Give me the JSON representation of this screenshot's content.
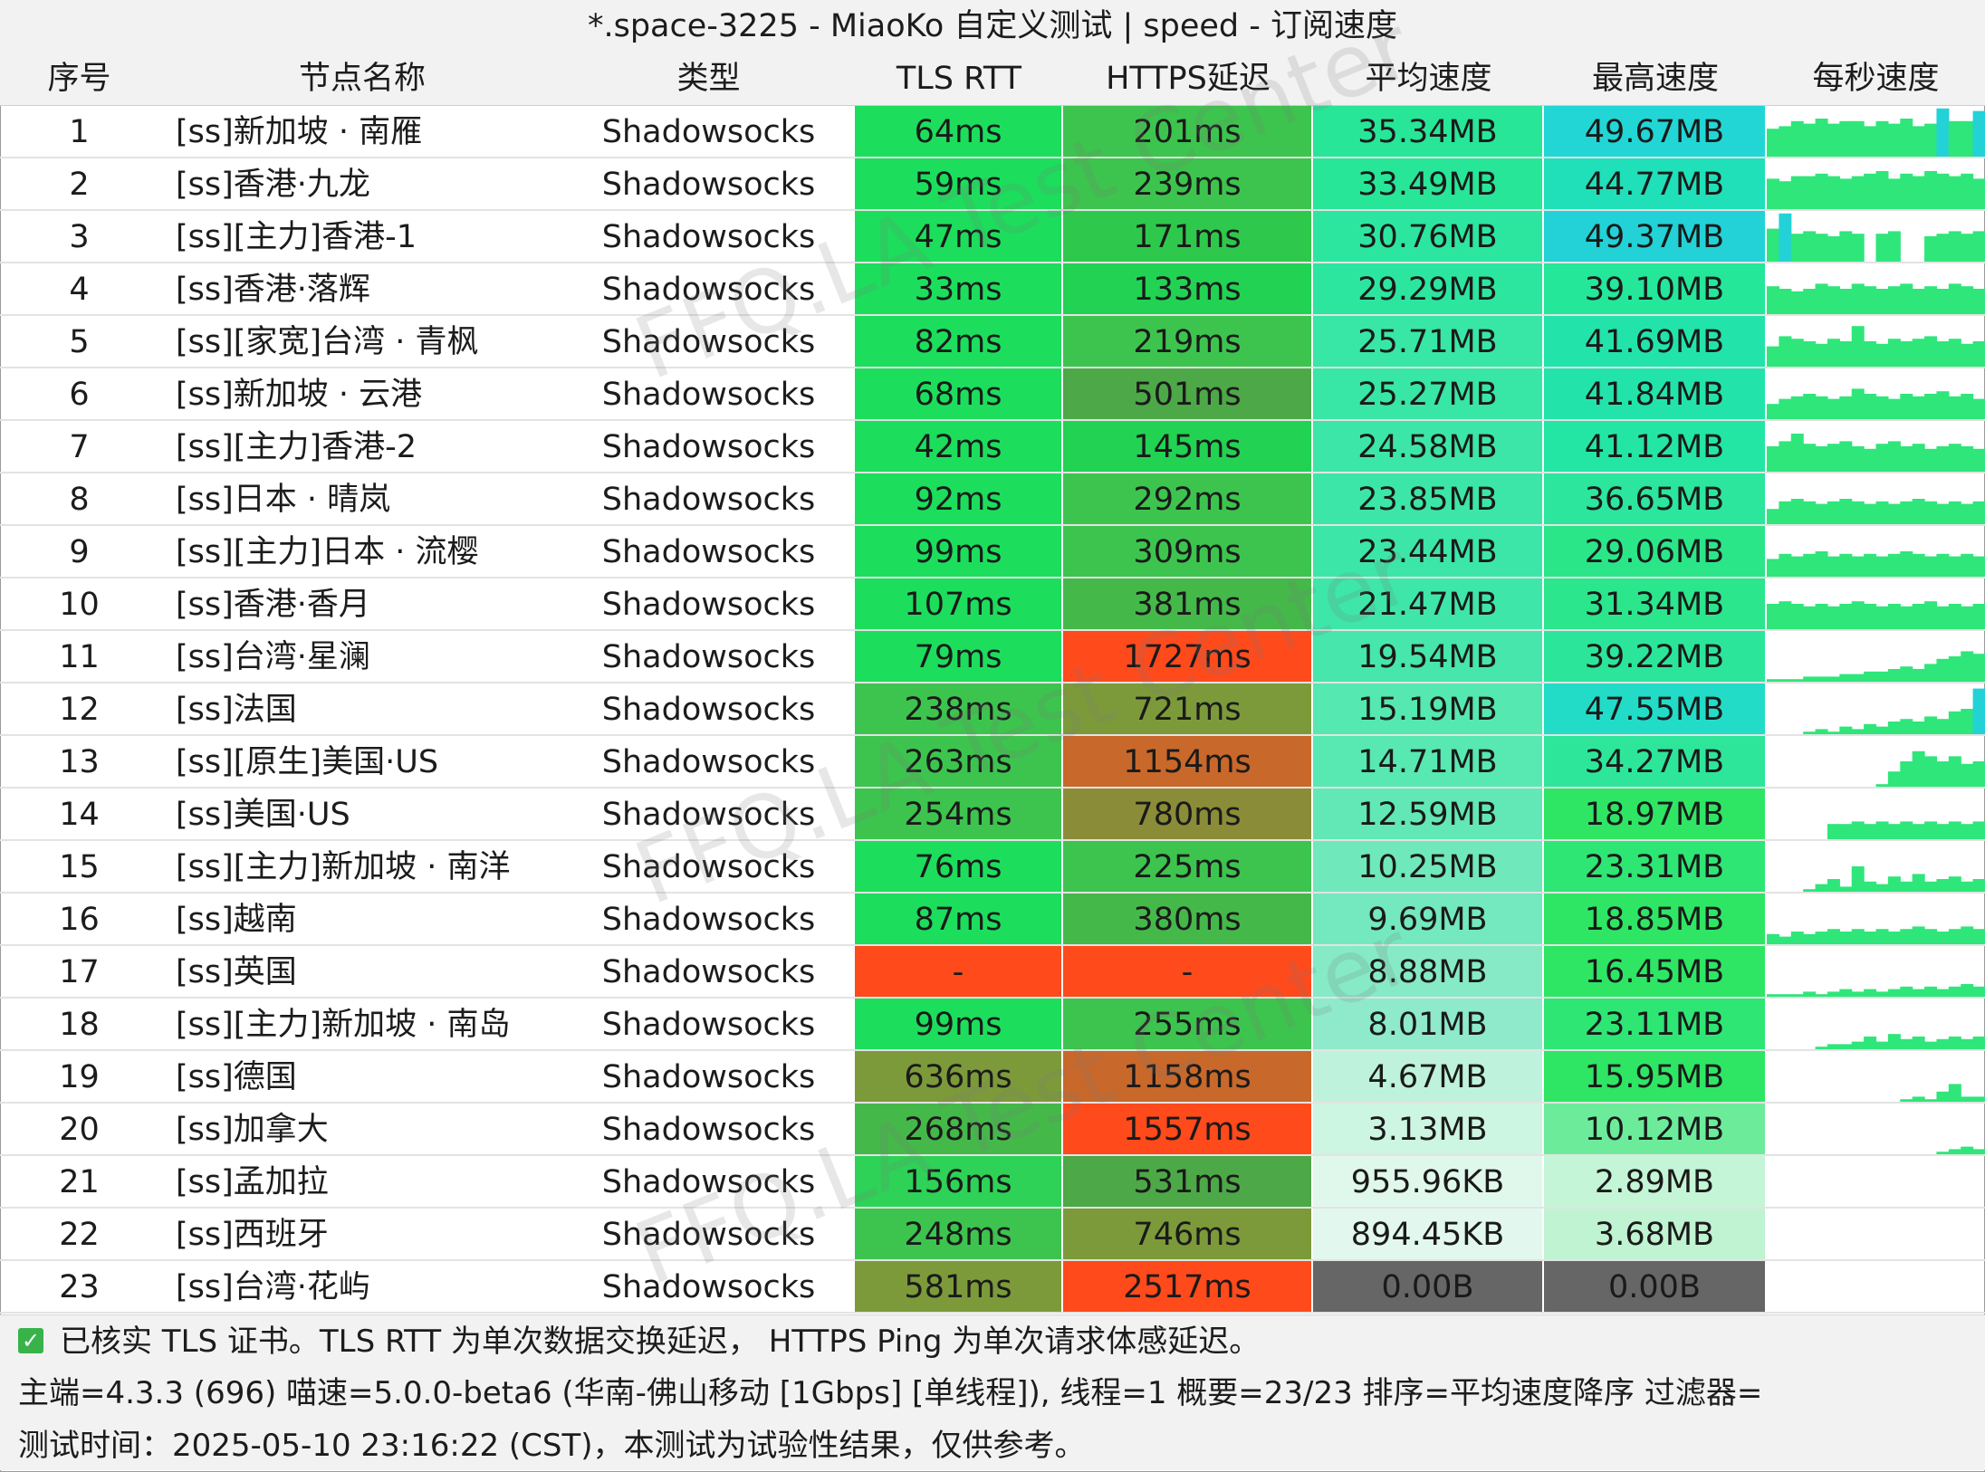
{
  "title": "*.space-3225 - MiaoKo 自定义测试 | speed - 订阅速度",
  "headers": [
    "序号",
    "节点名称",
    "类型",
    "TLS RTT",
    "HTTPS延迟",
    "平均速度",
    "最高速度",
    "每秒速度"
  ],
  "rows": [
    {
      "idx": "1",
      "name": "[ss]新加坡 · 南雁",
      "type": "Shadowsocks",
      "tls": "64ms",
      "https": "201ms",
      "avg": "35.34MB",
      "max": "49.67MB",
      "bg": [
        "#1cde5c",
        "#3dc44e",
        "#27e698",
        "#22d6d6"
      ],
      "spark": [
        0.55,
        0.6,
        0.7,
        0.65,
        0.75,
        0.65,
        0.7,
        0.7,
        0.6,
        0.7,
        0.65,
        0.75,
        0.6,
        0.65,
        0.95,
        0.7,
        0.7,
        0.9
      ]
    },
    {
      "idx": "2",
      "name": "[ss]香港·九龙",
      "type": "Shadowsocks",
      "tls": "59ms",
      "https": "239ms",
      "avg": "33.49MB",
      "max": "44.77MB",
      "bg": [
        "#1cde5c",
        "#3dc44e",
        "#27e698",
        "#1fe0b8"
      ],
      "spark": [
        0.6,
        0.55,
        0.65,
        0.65,
        0.7,
        0.65,
        0.6,
        0.65,
        0.7,
        0.75,
        0.6,
        0.7,
        0.65,
        0.75,
        0.7,
        0.65,
        0.7,
        0.6
      ]
    },
    {
      "idx": "3",
      "name": "[ss][主力]香港-1",
      "type": "Shadowsocks",
      "tls": "47ms",
      "https": "171ms",
      "avg": "30.76MB",
      "max": "49.37MB",
      "bg": [
        "#1cde5c",
        "#2ec94c",
        "#2ce6a0",
        "#22d2d6"
      ],
      "spark": [
        0.65,
        0.95,
        0.55,
        0.6,
        0.55,
        0.5,
        0.6,
        0.55,
        0.0,
        0.55,
        0.6,
        0.0,
        0.0,
        0.5,
        0.55,
        0.6,
        0.55,
        0.6
      ]
    },
    {
      "idx": "4",
      "name": "[ss]香港·落辉",
      "type": "Shadowsocks",
      "tls": "33ms",
      "https": "133ms",
      "avg": "29.29MB",
      "max": "39.10MB",
      "bg": [
        "#1cde5c",
        "#22d253",
        "#2ce6a0",
        "#24e79a"
      ],
      "spark": [
        0.55,
        0.5,
        0.45,
        0.5,
        0.6,
        0.55,
        0.5,
        0.6,
        0.55,
        0.5,
        0.55,
        0.6,
        0.5,
        0.55,
        0.5,
        0.6,
        0.55,
        0.5
      ]
    },
    {
      "idx": "5",
      "name": "[ss][家宽]台湾 · 青枫",
      "type": "Shadowsocks",
      "tls": "82ms",
      "https": "219ms",
      "avg": "25.71MB",
      "max": "41.69MB",
      "bg": [
        "#1cde5c",
        "#3dc44e",
        "#38e6a6",
        "#22e4aa"
      ],
      "spark": [
        0.4,
        0.6,
        0.55,
        0.5,
        0.45,
        0.55,
        0.5,
        0.8,
        0.5,
        0.45,
        0.55,
        0.5,
        0.55,
        0.6,
        0.5,
        0.55,
        0.45,
        0.5
      ]
    },
    {
      "idx": "6",
      "name": "[ss]新加坡 · 云港",
      "type": "Shadowsocks",
      "tls": "68ms",
      "https": "501ms",
      "avg": "25.27MB",
      "max": "41.84MB",
      "bg": [
        "#1cde5c",
        "#4da847",
        "#38e6a6",
        "#22e4aa"
      ],
      "spark": [
        0.3,
        0.4,
        0.45,
        0.5,
        0.45,
        0.4,
        0.45,
        0.6,
        0.5,
        0.45,
        0.4,
        0.5,
        0.45,
        0.5,
        0.55,
        0.45,
        0.5,
        0.4
      ]
    },
    {
      "idx": "7",
      "name": "[ss][主力]香港-2",
      "type": "Shadowsocks",
      "tls": "42ms",
      "https": "145ms",
      "avg": "24.58MB",
      "max": "41.12MB",
      "bg": [
        "#1cde5c",
        "#22d253",
        "#3ce6a8",
        "#24e6a4"
      ],
      "spark": [
        0.5,
        0.6,
        0.75,
        0.55,
        0.5,
        0.55,
        0.6,
        0.5,
        0.45,
        0.55,
        0.6,
        0.5,
        0.55,
        0.45,
        0.5,
        0.55,
        0.5,
        0.45
      ]
    },
    {
      "idx": "8",
      "name": "[ss]日本 · 晴岚",
      "type": "Shadowsocks",
      "tls": "92ms",
      "https": "292ms",
      "avg": "23.85MB",
      "max": "36.65MB",
      "bg": [
        "#1cde5c",
        "#3dc44e",
        "#3ce6a8",
        "#2be69c"
      ],
      "spark": [
        0.3,
        0.45,
        0.5,
        0.45,
        0.4,
        0.45,
        0.5,
        0.45,
        0.4,
        0.45,
        0.4,
        0.45,
        0.5,
        0.45,
        0.4,
        0.45,
        0.4,
        0.45
      ]
    },
    {
      "idx": "9",
      "name": "[ss][主力]日本 · 流樱",
      "type": "Shadowsocks",
      "tls": "99ms",
      "https": "309ms",
      "avg": "23.44MB",
      "max": "29.06MB",
      "bg": [
        "#1cde5c",
        "#3dc44e",
        "#3ce6a8",
        "#2be688"
      ],
      "spark": [
        0.35,
        0.45,
        0.4,
        0.45,
        0.5,
        0.4,
        0.45,
        0.4,
        0.45,
        0.4,
        0.45,
        0.5,
        0.45,
        0.4,
        0.45,
        0.4,
        0.45,
        0.4
      ]
    },
    {
      "idx": "10",
      "name": "[ss]香港·香月",
      "type": "Shadowsocks",
      "tls": "107ms",
      "https": "381ms",
      "avg": "21.47MB",
      "max": "31.34MB",
      "bg": [
        "#1cde5c",
        "#45b84a",
        "#3fe6aa",
        "#2be68c"
      ],
      "spark": [
        0.5,
        0.55,
        0.5,
        0.45,
        0.5,
        0.45,
        0.5,
        0.55,
        0.5,
        0.45,
        0.5,
        0.45,
        0.5,
        0.55,
        0.45,
        0.5,
        0.45,
        0.5
      ]
    },
    {
      "idx": "11",
      "name": "[ss]台湾·星澜",
      "type": "Shadowsocks",
      "tls": "79ms",
      "https": "1727ms",
      "avg": "19.54MB",
      "max": "39.22MB",
      "bg": [
        "#1cde5c",
        "#ff4a1c",
        "#46e6ac",
        "#2be69a"
      ],
      "spark": [
        0.05,
        0.05,
        0.05,
        0.1,
        0.1,
        0.1,
        0.15,
        0.15,
        0.2,
        0.2,
        0.25,
        0.3,
        0.25,
        0.35,
        0.45,
        0.5,
        0.6,
        0.55
      ]
    },
    {
      "idx": "12",
      "name": "[ss]法国",
      "type": "Shadowsocks",
      "tls": "238ms",
      "https": "721ms",
      "avg": "15.19MB",
      "max": "47.55MB",
      "bg": [
        "#3dc44e",
        "#7c9a3a",
        "#55e8b0",
        "#22dcc8"
      ],
      "spark": [
        0.0,
        0.0,
        0.0,
        0.05,
        0.1,
        0.05,
        0.15,
        0.1,
        0.2,
        0.15,
        0.25,
        0.3,
        0.25,
        0.35,
        0.3,
        0.45,
        0.5,
        0.9
      ]
    },
    {
      "idx": "13",
      "name": "[ss][原生]美国·US",
      "type": "Shadowsocks",
      "tls": "263ms",
      "https": "1154ms",
      "avg": "14.71MB",
      "max": "34.27MB",
      "bg": [
        "#3dc44e",
        "#c8682a",
        "#58e8b2",
        "#2ee69a"
      ],
      "spark": [
        0.0,
        0.0,
        0.0,
        0.0,
        0.0,
        0.0,
        0.0,
        0.0,
        0.0,
        0.05,
        0.3,
        0.5,
        0.7,
        0.6,
        0.5,
        0.6,
        0.45,
        0.5
      ]
    },
    {
      "idx": "14",
      "name": "[ss]美国·US",
      "type": "Shadowsocks",
      "tls": "254ms",
      "https": "780ms",
      "avg": "12.59MB",
      "max": "18.97MB",
      "bg": [
        "#3dc44e",
        "#8a8c38",
        "#62e8b6",
        "#2ee664"
      ],
      "spark": [
        0.0,
        0.0,
        0.0,
        0.0,
        0.0,
        0.3,
        0.3,
        0.35,
        0.3,
        0.35,
        0.3,
        0.35,
        0.3,
        0.35,
        0.3,
        0.35,
        0.3,
        0.35
      ]
    },
    {
      "idx": "15",
      "name": "[ss][主力]新加坡 · 南洋",
      "type": "Shadowsocks",
      "tls": "76ms",
      "https": "225ms",
      "avg": "10.25MB",
      "max": "23.31MB",
      "bg": [
        "#1cde5c",
        "#3dc44e",
        "#6fe8bc",
        "#2ee674"
      ],
      "spark": [
        0.0,
        0.0,
        0.0,
        0.05,
        0.15,
        0.25,
        0.1,
        0.5,
        0.2,
        0.15,
        0.3,
        0.2,
        0.35,
        0.2,
        0.25,
        0.3,
        0.2,
        0.25
      ]
    },
    {
      "idx": "16",
      "name": "[ss]越南",
      "type": "Shadowsocks",
      "tls": "87ms",
      "https": "380ms",
      "avg": "9.69MB",
      "max": "18.85MB",
      "bg": [
        "#1cde5c",
        "#45b84a",
        "#74e8be",
        "#2ee664"
      ],
      "spark": [
        0.2,
        0.15,
        0.25,
        0.2,
        0.25,
        0.3,
        0.25,
        0.3,
        0.25,
        0.3,
        0.25,
        0.3,
        0.35,
        0.3,
        0.25,
        0.3,
        0.35,
        0.3
      ]
    },
    {
      "idx": "17",
      "name": "[ss]英国",
      "type": "Shadowsocks",
      "tls": "-",
      "https": "-",
      "avg": "8.88MB",
      "max": "16.45MB",
      "bg": [
        "#ff4a1c",
        "#ff4a1c",
        "#86eac6",
        "#2ee664"
      ],
      "spark": [
        0.05,
        0.05,
        0.05,
        0.1,
        0.05,
        0.1,
        0.15,
        0.1,
        0.15,
        0.1,
        0.15,
        0.2,
        0.15,
        0.2,
        0.15,
        0.2,
        0.25,
        0.2
      ]
    },
    {
      "idx": "18",
      "name": "[ss][主力]新加坡 · 南岛",
      "type": "Shadowsocks",
      "tls": "99ms",
      "https": "255ms",
      "avg": "8.01MB",
      "max": "23.11MB",
      "bg": [
        "#1cde5c",
        "#3dc44e",
        "#8eeacb",
        "#2ee674"
      ],
      "spark": [
        0.0,
        0.0,
        0.0,
        0.0,
        0.05,
        0.1,
        0.1,
        0.15,
        0.25,
        0.15,
        0.3,
        0.2,
        0.25,
        0.15,
        0.2,
        0.25,
        0.2,
        0.25
      ]
    },
    {
      "idx": "19",
      "name": "[ss]德国",
      "type": "Shadowsocks",
      "tls": "636ms",
      "https": "1158ms",
      "avg": "4.67MB",
      "max": "15.95MB",
      "bg": [
        "#7c9a3a",
        "#c8682a",
        "#bff2dc",
        "#2ee664"
      ],
      "spark": [
        0.0,
        0.0,
        0.0,
        0.0,
        0.0,
        0.0,
        0.0,
        0.0,
        0.0,
        0.0,
        0.0,
        0.05,
        0.1,
        0.05,
        0.2,
        0.35,
        0.1,
        0.1
      ]
    },
    {
      "idx": "20",
      "name": "[ss]加拿大",
      "type": "Shadowsocks",
      "tls": "268ms",
      "https": "1557ms",
      "avg": "3.13MB",
      "max": "10.12MB",
      "bg": [
        "#45b84a",
        "#ff4a1c",
        "#ccf5e2",
        "#6cec9a"
      ],
      "spark": [
        0.0,
        0.0,
        0.0,
        0.0,
        0.0,
        0.0,
        0.0,
        0.0,
        0.0,
        0.0,
        0.0,
        0.0,
        0.0,
        0.0,
        0.05,
        0.1,
        0.15,
        0.1
      ]
    },
    {
      "idx": "21",
      "name": "[ss]孟加拉",
      "type": "Shadowsocks",
      "tls": "156ms",
      "https": "531ms",
      "avg": "955.96KB",
      "max": "2.89MB",
      "bg": [
        "#2ed256",
        "#4da847",
        "#e0f8ec",
        "#c4f5d6"
      ],
      "spark": [
        0,
        0,
        0,
        0,
        0,
        0,
        0,
        0,
        0,
        0,
        0,
        0,
        0,
        0,
        0,
        0,
        0,
        0
      ]
    },
    {
      "idx": "22",
      "name": "[ss]西班牙",
      "type": "Shadowsocks",
      "tls": "248ms",
      "https": "746ms",
      "avg": "894.45KB",
      "max": "3.68MB",
      "bg": [
        "#3dc44e",
        "#7c9a3a",
        "#e2f8ee",
        "#bff3d2"
      ],
      "spark": [
        0,
        0,
        0,
        0,
        0,
        0,
        0,
        0,
        0,
        0,
        0,
        0,
        0,
        0,
        0,
        0,
        0,
        0
      ]
    },
    {
      "idx": "23",
      "name": "[ss]台湾·花屿",
      "type": "Shadowsocks",
      "tls": "581ms",
      "https": "2517ms",
      "avg": "0.00B",
      "max": "0.00B",
      "bg": [
        "#7c9a3a",
        "#ff4a1c",
        "#666666",
        "#666666"
      ],
      "spark": [
        0,
        0,
        0,
        0,
        0,
        0,
        0,
        0,
        0,
        0,
        0,
        0,
        0,
        0,
        0,
        0,
        0,
        0
      ]
    }
  ],
  "spark_color": "#2ee67a",
  "footer": {
    "check_icon": "check-icon",
    "line1": "已核实 TLS 证书。TLS RTT 为单次数据交换延迟， HTTPS Ping 为单次请求体感延迟。",
    "line2": "主端=4.3.3 (696) 喵速=5.0.0-beta6 (华南-佛山移动 [1Gbps] [单线程]), 线程=1 概要=23/23 排序=平均速度降序 过滤器=",
    "line3": "测试时间：2025-05-10 23:16:22 (CST)，本测试为试验性结果，仅供参考。"
  },
  "watermark": "FFQ.LA Test Center"
}
